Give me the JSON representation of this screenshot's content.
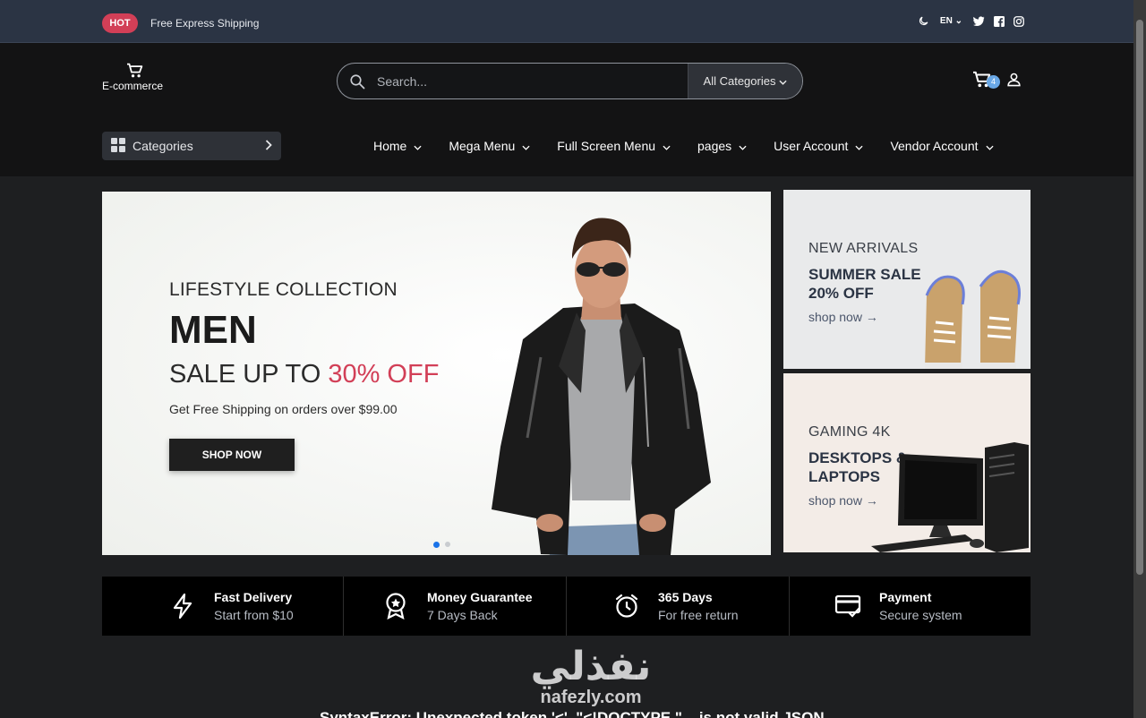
{
  "topbar": {
    "badge": "HOT",
    "shipping_text": "Free Express Shipping",
    "language": "EN",
    "icons": [
      "moon-icon",
      "twitter-icon",
      "facebook-icon",
      "instagram-icon"
    ]
  },
  "header": {
    "logo_text": "E-commerce",
    "search_placeholder": "Search...",
    "category_select": "All Categories",
    "cart_count": "4"
  },
  "nav": {
    "categories_label": "Categories",
    "items": [
      "Home",
      "Mega Menu",
      "Full Screen Menu",
      "pages",
      "User Account",
      "Vendor Account"
    ]
  },
  "hero": {
    "eyebrow": "LIFESTYLE COLLECTION",
    "title": "MEN",
    "sale_prefix": "SALE UP TO ",
    "sale_percent": "30% OFF",
    "shipping_note": "Get Free Shipping on orders over $99.00",
    "button": "SHOP NOW",
    "slide_count": 2,
    "active_slide": 1
  },
  "side_banners": [
    {
      "kicker": "NEW ARRIVALS",
      "headline": "SUMMER SALE 20% OFF",
      "link": "shop now"
    },
    {
      "kicker": "GAMING 4K",
      "headline": "DESKTOPS & LAPTOPS",
      "link": "shop now"
    }
  ],
  "services": [
    {
      "icon": "lightning-icon",
      "title": "Fast Delivery",
      "subtitle": "Start from $10"
    },
    {
      "icon": "award-badge-icon",
      "title": "Money Guarantee",
      "subtitle": "7 Days Back"
    },
    {
      "icon": "alarm-clock-icon",
      "title": "365 Days",
      "subtitle": "For free return"
    },
    {
      "icon": "credit-card-check-icon",
      "title": "Payment",
      "subtitle": "Secure system"
    }
  ],
  "watermark": {
    "arabic": "نفذلي",
    "latin": "nafezly.com"
  },
  "error_text": "SyntaxError: Unexpected token '<', \"<!DOCTYPE \"... is not valid JSON",
  "colors": {
    "accent": "#d23f57",
    "topbar": "#2b3444",
    "header": "#131314",
    "page": "#1e1f21"
  }
}
